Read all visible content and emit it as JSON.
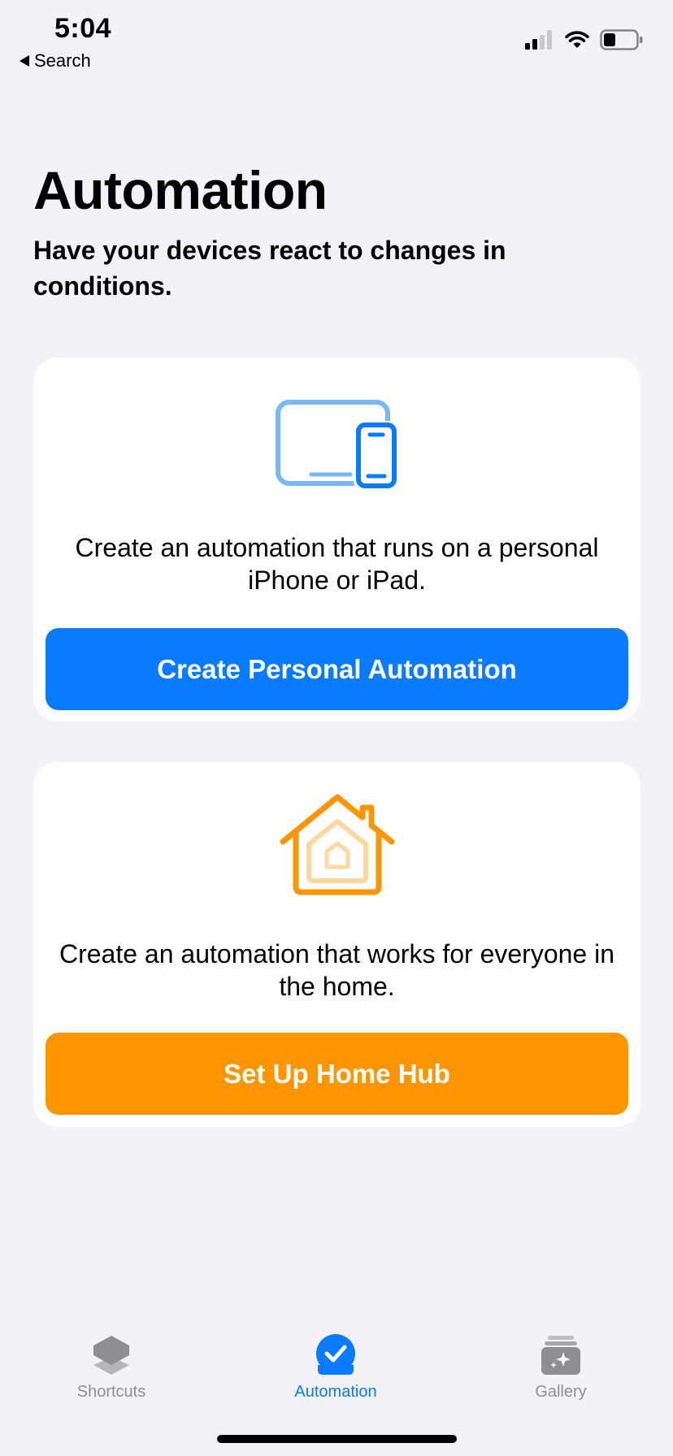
{
  "status_bar": {
    "time": "5:04",
    "back_label": "Search"
  },
  "page": {
    "title": "Automation",
    "subtitle": "Have your devices react to changes in conditions."
  },
  "cards": {
    "personal": {
      "icon": "devices-icon",
      "description": "Create an automation that runs on a personal iPhone or iPad.",
      "button_label": "Create Personal Automation",
      "button_color": "#0a7aff"
    },
    "home": {
      "icon": "home-icon",
      "description": "Create an automation that works for everyone in the home.",
      "button_label": "Set Up Home Hub",
      "button_color": "#ff9500"
    }
  },
  "tab_bar": {
    "tabs": [
      {
        "label": "Shortcuts",
        "icon": "layers-icon",
        "selected": false
      },
      {
        "label": "Automation",
        "icon": "checkmark-circle-icon",
        "selected": true
      },
      {
        "label": "Gallery",
        "icon": "gallery-icon",
        "selected": false
      }
    ]
  },
  "colors": {
    "background": "#f2f2f7",
    "accent": "#0a7aff",
    "home_accent": "#ff9500",
    "inactive": "#8e8e93"
  }
}
